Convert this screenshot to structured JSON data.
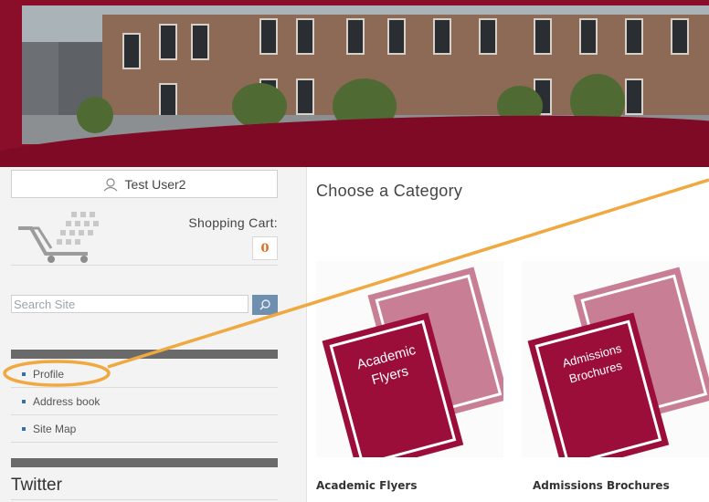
{
  "user": {
    "name": "Test User2"
  },
  "cart": {
    "label": "Shopping Cart:",
    "count": "0"
  },
  "search": {
    "placeholder": "Search Site"
  },
  "nav": {
    "items": [
      {
        "label": "Profile"
      },
      {
        "label": "Address book"
      },
      {
        "label": "Site Map"
      }
    ]
  },
  "twitter": {
    "heading": "Twitter"
  },
  "main": {
    "title": "Choose a Category",
    "categories": [
      {
        "label": "Academic Flyers",
        "cover_line1": "Academic",
        "cover_line2": "Flyers"
      },
      {
        "label": "Admissions Brochures",
        "cover_line1": "Admissions",
        "cover_line2": "Brochures"
      }
    ]
  },
  "colors": {
    "brand": "#8a0e2a",
    "highlight": "#f0a840",
    "cart_count": "#e06b1f",
    "book_front": "#9b0e3a",
    "book_back": "#c87f96"
  }
}
